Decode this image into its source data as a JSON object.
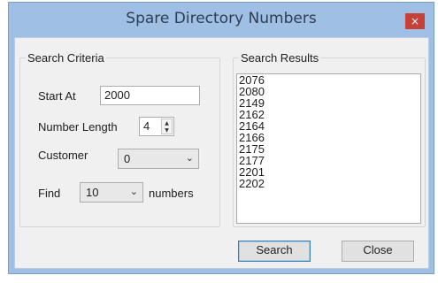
{
  "window": {
    "title": "Spare Directory Numbers",
    "close_glyph": "×"
  },
  "criteria": {
    "legend": "Search Criteria",
    "start_at": {
      "label": "Start At",
      "value": "2000"
    },
    "number_length": {
      "label": "Number Length",
      "value": "4"
    },
    "customer": {
      "label": "Customer",
      "value": "0"
    },
    "find": {
      "label": "Find",
      "value": "10",
      "suffix": "numbers"
    }
  },
  "results": {
    "legend": "Search Results",
    "items": [
      "2076",
      "2080",
      "2149",
      "2162",
      "2164",
      "2166",
      "2175",
      "2177",
      "2201",
      "2202"
    ]
  },
  "buttons": {
    "search": "Search",
    "close": "Close"
  },
  "icons": {
    "close": "close-icon",
    "dropdown": "chevron-down-icon",
    "spin_up": "spin-up-icon",
    "spin_down": "spin-down-icon"
  },
  "colors": {
    "titlebar": "#9fbfe4",
    "close_button": "#c7413a",
    "client": "#f0f0f0"
  }
}
